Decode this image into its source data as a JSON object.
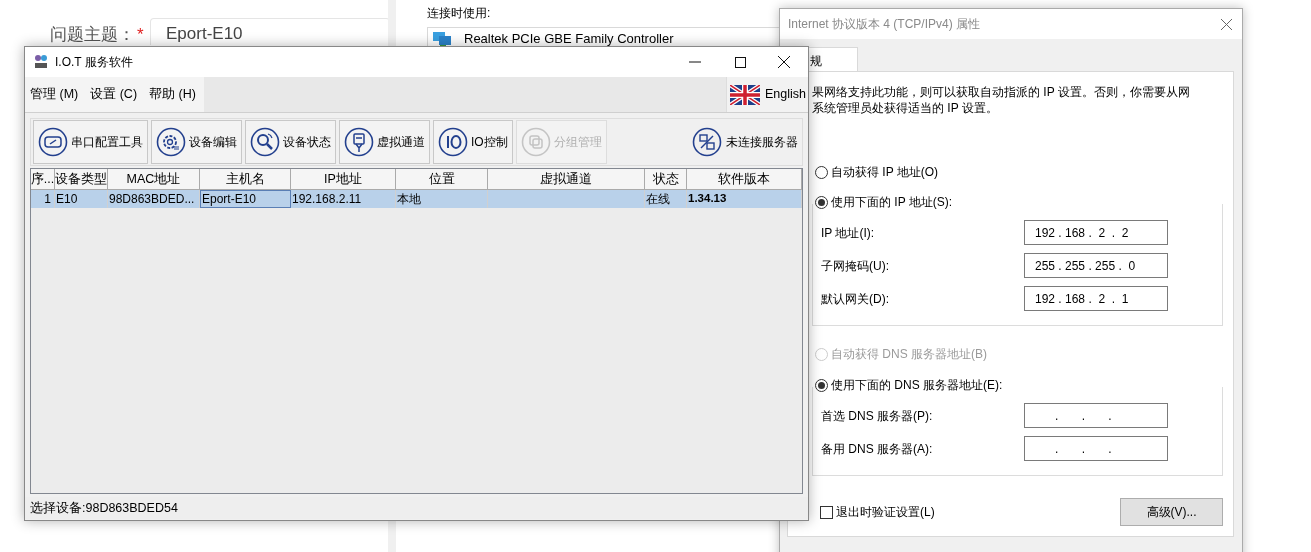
{
  "background_page": {
    "label": "问题主题：",
    "required_mark": "*",
    "field_value": "Eport-E10"
  },
  "adapter_window": {
    "label": "连接时使用:",
    "adapter": "Realtek PCIe GBE Family Controller"
  },
  "iot_window": {
    "title": "I.O.T 服务软件",
    "menus": [
      "管理 (M)",
      "设置 (C)",
      "帮助 (H)"
    ],
    "language": "English",
    "toolbar": [
      {
        "kind": "serial",
        "label": "串口配置工具",
        "disabled": false
      },
      {
        "kind": "gear",
        "label": "设备编辑",
        "disabled": false
      },
      {
        "kind": "search",
        "label": "设备状态",
        "disabled": false
      },
      {
        "kind": "plug",
        "label": "虚拟通道",
        "disabled": false
      },
      {
        "kind": "io",
        "label": "IO控制",
        "disabled": false
      },
      {
        "kind": "group",
        "label": "分组管理",
        "disabled": true
      }
    ],
    "server_status": {
      "label": "未连接服务器"
    },
    "table": {
      "columns": [
        "序...",
        "设备类型",
        "MAC地址",
        "主机名",
        "IP地址",
        "位置",
        "虚拟通道",
        "状态",
        "软件版本"
      ],
      "rows": [
        {
          "selected": true,
          "cells": [
            {
              "text": "1",
              "focused": false
            },
            {
              "text": "E10",
              "focused": false
            },
            {
              "text": "98D863BDED...",
              "focused": false
            },
            {
              "text": "Eport-E10",
              "focused": true
            },
            {
              "text": "192.168.2.11",
              "focused": false
            },
            {
              "text": "本地",
              "focused": false
            },
            {
              "text": "",
              "focused": false
            },
            {
              "text": "在线",
              "focused": false
            },
            {
              "text": "1.34.13",
              "focused": false
            }
          ]
        }
      ]
    },
    "status_bar": "选择设备:98D863BDED54"
  },
  "ipv4_dialog": {
    "title": "Internet 协议版本 4 (TCP/IPv4) 属性",
    "tab": "规",
    "description": [
      "果网络支持此功能，则可以获取自动指派的 IP 设置。否则，你需要从网",
      "系统管理员处获得适当的 IP 设置。"
    ],
    "ip_modes": [
      {
        "label": "自动获得 IP 地址(O)",
        "selected": false,
        "disabled": false
      },
      {
        "label": "使用下面的 IP 地址(S):",
        "selected": true,
        "disabled": false
      }
    ],
    "ip_fields": [
      {
        "label": "IP 地址(I):",
        "value": "192 . 168 .  2  .  2"
      },
      {
        "label": "子网掩码(U):",
        "value": "255 . 255 . 255 .  0"
      },
      {
        "label": "默认网关(D):",
        "value": "192 . 168 .  2  .  1"
      }
    ],
    "dns_modes": [
      {
        "label": "自动获得 DNS 服务器地址(B)",
        "selected": false,
        "disabled": true
      },
      {
        "label": "使用下面的 DNS 服务器地址(E):",
        "selected": true,
        "disabled": false
      }
    ],
    "dns_fields": [
      {
        "label": "首选 DNS 服务器(P):",
        "value": "      .       .       ."
      },
      {
        "label": "备用 DNS 服务器(A):",
        "value": "      .       .       ."
      }
    ],
    "validate_on_exit": {
      "label": "退出时验证设置(L)",
      "checked": false
    },
    "advanced_button": "高级(V)..."
  }
}
